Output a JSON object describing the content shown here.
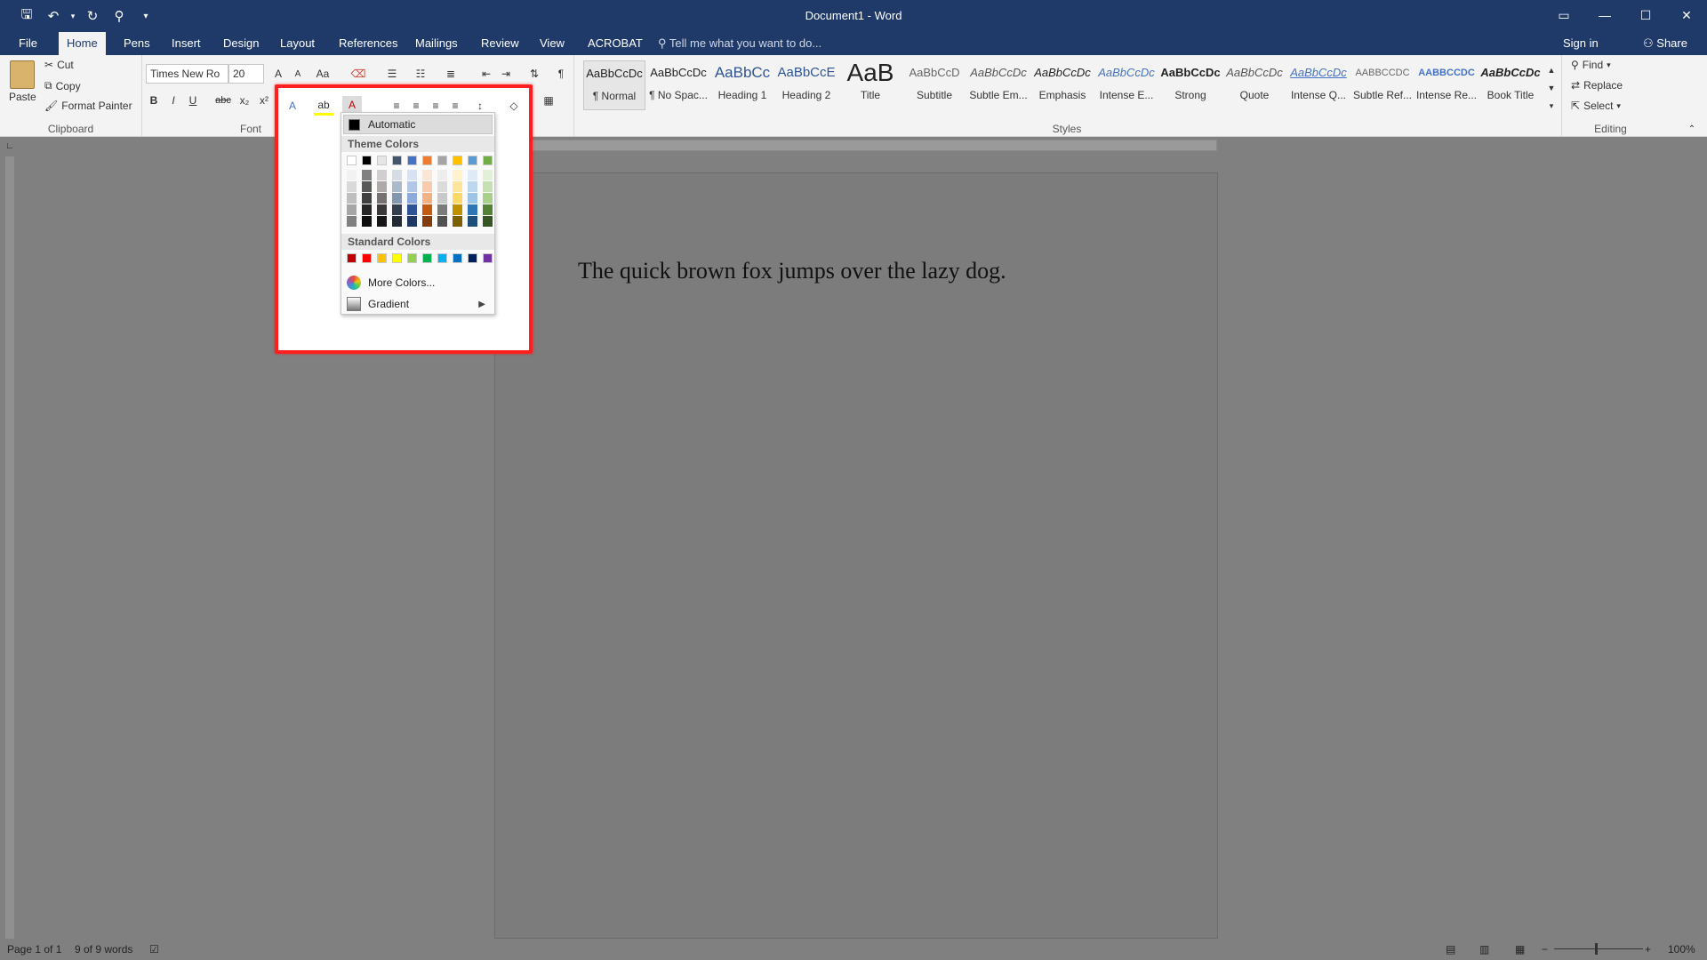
{
  "titlebar": {
    "title": "Document1 - Word"
  },
  "tabs": [
    "File",
    "Home",
    "Pens",
    "Insert",
    "Design",
    "Layout",
    "References",
    "Mailings",
    "Review",
    "View",
    "ACROBAT"
  ],
  "tellme": "Tell me what you want to do...",
  "signin": "Sign in",
  "share": "Share",
  "clipboard": {
    "paste": "Paste",
    "cut": "Cut",
    "copy": "Copy",
    "format_painter": "Format Painter",
    "label": "Clipboard"
  },
  "font": {
    "name": "Times New Ro",
    "size": "20",
    "label": "Font",
    "bold": "B",
    "italic": "I",
    "underline": "U",
    "strike": "abc",
    "sub": "x₂",
    "sup": "x²",
    "grow": "A",
    "shrink": "A",
    "case": "Aa"
  },
  "styles": {
    "label": "Styles",
    "items": [
      {
        "preview": "AaBbCcDc",
        "name": "¶ Normal"
      },
      {
        "preview": "AaBbCcDc",
        "name": "¶ No Spac..."
      },
      {
        "preview": "AaBbCc",
        "name": "Heading 1"
      },
      {
        "preview": "AaBbCcE",
        "name": "Heading 2"
      },
      {
        "preview": "AaB",
        "name": "Title"
      },
      {
        "preview": "AaBbCcD",
        "name": "Subtitle"
      },
      {
        "preview": "AaBbCcDc",
        "name": "Subtle Em..."
      },
      {
        "preview": "AaBbCcDc",
        "name": "Emphasis"
      },
      {
        "preview": "AaBbCcDc",
        "name": "Intense E..."
      },
      {
        "preview": "AaBbCcDc",
        "name": "Strong"
      },
      {
        "preview": "AaBbCcDc",
        "name": "Quote"
      },
      {
        "preview": "AaBbCcDc",
        "name": "Intense Q..."
      },
      {
        "preview": "AABBCCDC",
        "name": "Subtle Ref..."
      },
      {
        "preview": "AABBCCDC",
        "name": "Intense Re..."
      },
      {
        "preview": "AaBbCcDc",
        "name": "Book Title"
      }
    ]
  },
  "editing": {
    "find": "Find",
    "replace": "Replace",
    "select": "Select",
    "label": "Editing"
  },
  "color_menu": {
    "automatic": "Automatic",
    "theme_header": "Theme Colors",
    "standard_header": "Standard Colors",
    "more_colors": "More Colors...",
    "gradient": "Gradient",
    "theme_top": [
      "#ffffff",
      "#000000",
      "#e7e6e6",
      "#44546a",
      "#4472c4",
      "#ed7d31",
      "#a5a5a5",
      "#ffc000",
      "#5b9bd5",
      "#70ad47"
    ],
    "theme_shades": [
      [
        "#f2f2f2",
        "#d9d9d9",
        "#bfbfbf",
        "#a6a6a6",
        "#808080"
      ],
      [
        "#808080",
        "#595959",
        "#404040",
        "#262626",
        "#0d0d0d"
      ],
      [
        "#d0cece",
        "#aeaaaa",
        "#757171",
        "#3a3838",
        "#171616"
      ],
      [
        "#d6dce4",
        "#acb9ca",
        "#8497b0",
        "#333f4f",
        "#222a35"
      ],
      [
        "#d9e2f3",
        "#b4c6e7",
        "#8eaadb",
        "#2f5496",
        "#1f3864"
      ],
      [
        "#fbe5d5",
        "#f7cbac",
        "#f4b183",
        "#c55a11",
        "#833c0b"
      ],
      [
        "#ededed",
        "#dbdbdb",
        "#c9c9c9",
        "#7b7b7b",
        "#525252"
      ],
      [
        "#fff2cc",
        "#fee599",
        "#ffd965",
        "#bf9000",
        "#7f6000"
      ],
      [
        "#deeaf6",
        "#bdd7ee",
        "#9dc3e6",
        "#2e75b5",
        "#1e4e79"
      ],
      [
        "#e2efd9",
        "#c5e0b3",
        "#a8d08d",
        "#538135",
        "#375623"
      ]
    ],
    "standard": [
      "#c00000",
      "#ff0000",
      "#ffc000",
      "#ffff00",
      "#92d050",
      "#00b050",
      "#00b0f0",
      "#0070c0",
      "#002060",
      "#7030a0"
    ]
  },
  "document": {
    "text": "The quick brown fox jumps over the lazy dog."
  },
  "status": {
    "page": "Page 1 of 1",
    "words": "9 of 9 words",
    "zoom": "100%"
  }
}
